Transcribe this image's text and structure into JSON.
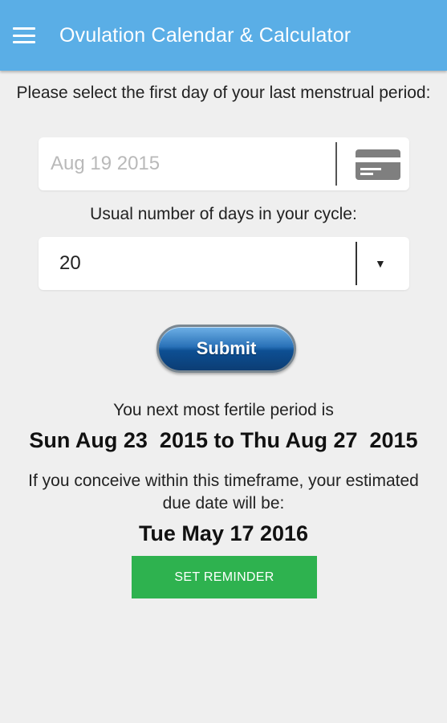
{
  "header": {
    "title": "Ovulation Calendar & Calculator"
  },
  "form": {
    "date_prompt": "Please select the first day of your last menstrual period:",
    "date_value": "Aug 19 2015",
    "cycle_label": "Usual number of days in your cycle:",
    "cycle_value": "20",
    "submit_label": "Submit"
  },
  "result": {
    "fertile_label": "You next most fertile period is",
    "fertile_range": "Sun Aug 23  2015 to Thu Aug 27  2015",
    "conceive_label": "If you conceive within this timeframe, your estimated due date will be:",
    "due_date": "Tue May 17 2016",
    "reminder_label": "SET REMINDER"
  },
  "icons": {
    "menu": "menu-icon",
    "calendar_card": "card-icon",
    "dropdown": "dropdown-arrow-icon"
  },
  "colors": {
    "appbar": "#5aaee6",
    "background": "#efefef",
    "reminder_button": "#2eb24f",
    "submit_button": "#1e64a8"
  }
}
